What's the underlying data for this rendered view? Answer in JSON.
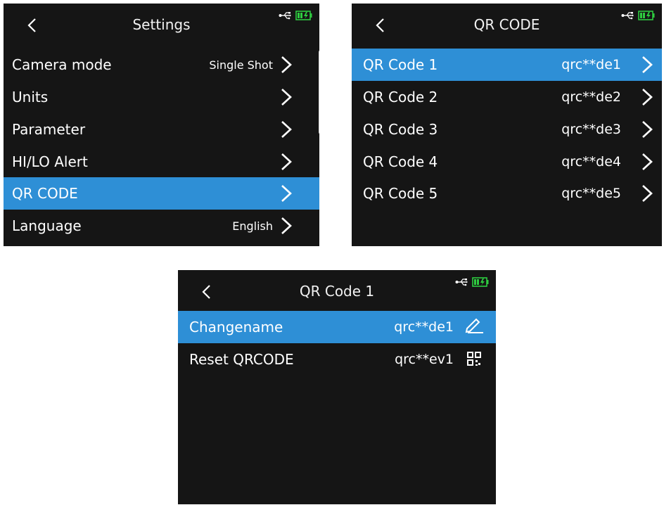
{
  "status": {
    "usb": "usb-icon",
    "battery": "battery-charging-icon",
    "battery_color": "#2ecc40"
  },
  "accent": "#2e8fd6",
  "settings": {
    "title": "Settings",
    "items": [
      {
        "label": "Camera mode",
        "value": "Single Shot"
      },
      {
        "label": "Units",
        "value": ""
      },
      {
        "label": "Parameter",
        "value": ""
      },
      {
        "label": "HI/LO Alert",
        "value": ""
      },
      {
        "label": "QR CODE",
        "value": "",
        "selected": true
      },
      {
        "label": "Language",
        "value": "English"
      }
    ]
  },
  "qr_code": {
    "title": "QR CODE",
    "items": [
      {
        "label": "QR Code 1",
        "value": "qrc**de1",
        "selected": true
      },
      {
        "label": "QR Code 2",
        "value": "qrc**de2"
      },
      {
        "label": "QR Code 3",
        "value": "qrc**de3"
      },
      {
        "label": "QR Code 4",
        "value": "qrc**de4"
      },
      {
        "label": "QR Code 5",
        "value": "qrc**de5"
      }
    ]
  },
  "qr_code_1": {
    "title": "QR Code 1",
    "items": [
      {
        "label": "Changename",
        "value": "qrc**de1",
        "icon": "pencil-icon",
        "selected": true
      },
      {
        "label": "Reset QRCODE",
        "value": "qrc**ev1",
        "icon": "qr-code-icon"
      }
    ]
  }
}
